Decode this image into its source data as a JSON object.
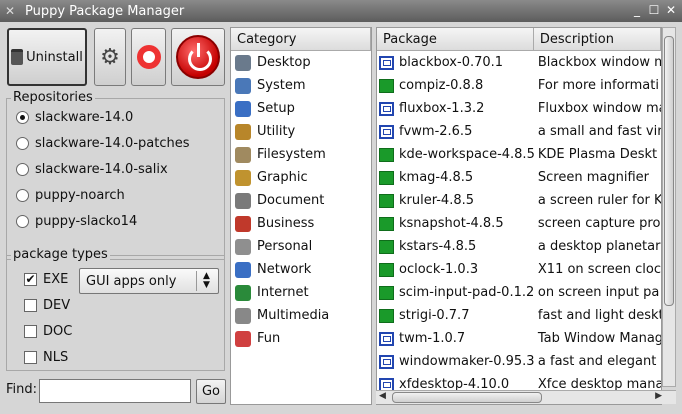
{
  "window": {
    "title": "Puppy Package Manager"
  },
  "toolbar": {
    "uninstall_label": "Uninstall"
  },
  "repositories": {
    "title": "Repositories",
    "items": [
      {
        "label": "slackware-14.0",
        "selected": true
      },
      {
        "label": "slackware-14.0-patches",
        "selected": false
      },
      {
        "label": "slackware-14.0-salix",
        "selected": false
      },
      {
        "label": "puppy-noarch",
        "selected": false
      },
      {
        "label": "puppy-slacko14",
        "selected": false
      }
    ]
  },
  "package_types": {
    "title": "package types",
    "items": [
      {
        "label": "EXE",
        "checked": true
      },
      {
        "label": "DEV",
        "checked": false
      },
      {
        "label": "DOC",
        "checked": false
      },
      {
        "label": "NLS",
        "checked": false
      }
    ],
    "filter_value": "GUI apps only"
  },
  "find": {
    "label": "Find:",
    "value": "",
    "button": "Go"
  },
  "categories": {
    "header": "Category",
    "items": [
      {
        "label": "Desktop",
        "icon": "desktop-icon",
        "color": "#6a7a8c"
      },
      {
        "label": "System",
        "icon": "system-icon",
        "color": "#4a78b8"
      },
      {
        "label": "Setup",
        "icon": "setup-icon",
        "color": "#3a6fc4"
      },
      {
        "label": "Utility",
        "icon": "utility-icon",
        "color": "#b8862a"
      },
      {
        "label": "Filesystem",
        "icon": "filesystem-icon",
        "color": "#a08a60"
      },
      {
        "label": "Graphic",
        "icon": "graphic-icon",
        "color": "#c0932f"
      },
      {
        "label": "Document",
        "icon": "document-icon",
        "color": "#7a7a7a"
      },
      {
        "label": "Business",
        "icon": "business-icon",
        "color": "#c0392b"
      },
      {
        "label": "Personal",
        "icon": "personal-icon",
        "color": "#8f8f8f"
      },
      {
        "label": "Network",
        "icon": "network-icon",
        "color": "#3a6fc4"
      },
      {
        "label": "Internet",
        "icon": "internet-icon",
        "color": "#2a8a3a"
      },
      {
        "label": "Multimedia",
        "icon": "multimedia-icon",
        "color": "#888888"
      },
      {
        "label": "Fun",
        "icon": "fun-icon",
        "color": "#d04040"
      }
    ]
  },
  "packages": {
    "headers": {
      "name": "Package",
      "description": "Description"
    },
    "rows": [
      {
        "name": "blackbox-0.70.1",
        "description": "Blackbox window m",
        "icon": "window"
      },
      {
        "name": "compiz-0.8.8",
        "description": "For more informati",
        "icon": "green"
      },
      {
        "name": "fluxbox-1.3.2",
        "description": "Fluxbox window ma",
        "icon": "window"
      },
      {
        "name": "fvwm-2.6.5",
        "description": "a small and fast vir",
        "icon": "window"
      },
      {
        "name": "kde-workspace-4.8.5",
        "description": "KDE Plasma Deskt",
        "icon": "green"
      },
      {
        "name": "kmag-4.8.5",
        "description": "Screen magnifier",
        "icon": "green"
      },
      {
        "name": "kruler-4.8.5",
        "description": "a screen ruler for K",
        "icon": "green"
      },
      {
        "name": "ksnapshot-4.8.5",
        "description": "screen capture pro",
        "icon": "green"
      },
      {
        "name": "kstars-4.8.5",
        "description": "a desktop planetar",
        "icon": "green"
      },
      {
        "name": "oclock-1.0.3",
        "description": "X11 on screen clocl",
        "icon": "green"
      },
      {
        "name": "scim-input-pad-0.1.2",
        "description": "on screen input pa",
        "icon": "green"
      },
      {
        "name": "strigi-0.7.7",
        "description": "fast and light deskt",
        "icon": "green"
      },
      {
        "name": "twm-1.0.7",
        "description": "Tab Window Manag",
        "icon": "window"
      },
      {
        "name": "windowmaker-0.95.3",
        "description": "a fast and elegant",
        "icon": "window"
      },
      {
        "name": "xfdesktop-4.10.0",
        "description": "Xfce desktop mana",
        "icon": "window"
      }
    ]
  }
}
